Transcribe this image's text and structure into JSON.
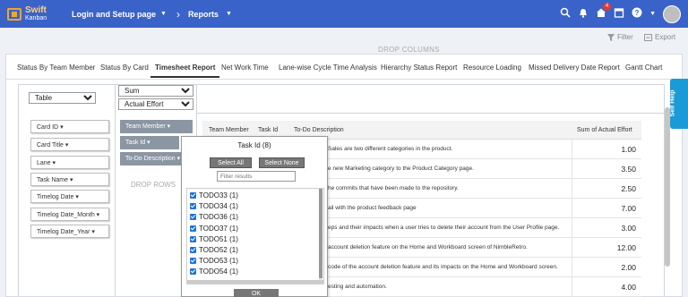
{
  "app": {
    "logo_line1": "Swift",
    "logo_line2": "Kanban",
    "breadcrumb_board": "Login and Setup page",
    "breadcrumb_section": "Reports",
    "notification_count": "4"
  },
  "toolbar": {
    "filter_label": "Filter",
    "export_label": "Export"
  },
  "tabs": [
    "Status By Team Member",
    "Status By Card",
    "Timesheet Report",
    "Net Work Time",
    "Lane-wise Cycle Time Analysis",
    "Hierarchy Status Report",
    "Resource Loading",
    "Missed Delivery Date Report",
    "Gantt Chart"
  ],
  "active_tab": "Timesheet Report",
  "pivot": {
    "renderer": "Table",
    "aggregator": "Sum",
    "aggregator_field": "Actual Effort",
    "drop_columns": "DROP COLUMNS",
    "drop_rows": "DROP ROWS",
    "available_fields": [
      "Card ID",
      "Card Title",
      "Lane",
      "Task Name",
      "Timelog Date",
      "Timelog Date_Month",
      "Timelog Date_Year"
    ],
    "row_fields": [
      "Team Member",
      "Task Id",
      "To-Do Description"
    ]
  },
  "table": {
    "headers": {
      "team_member": "Team Member",
      "task_id": "Task Id",
      "todo": "To-Do Description",
      "sum": "Sum of Actual Effort"
    },
    "rows": [
      {
        "desc": "Sales are two different categories in the product.",
        "value": "1.00"
      },
      {
        "desc": "e new Marketing category to the Product Category page.",
        "value": "3.50"
      },
      {
        "desc": "he commits that have been made to the repository.",
        "value": "2.50"
      },
      {
        "desc": "ail with the product feedback page",
        "value": "7.00"
      },
      {
        "desc": "eps and their impacts when a user tries to delete their account from the User Profile page.",
        "value": "3.00"
      },
      {
        "desc": "account deletion feature on the Home and Workboard screen of NimbleRetro.",
        "value": "12.00"
      },
      {
        "desc": "code of the account deletion feature and its impacts on the Home and Workboard screen.",
        "value": "2.00"
      },
      {
        "desc": "esting and automation.",
        "value": "4.00"
      }
    ]
  },
  "popup": {
    "title": "Task Id (8)",
    "select_all": "Select All",
    "select_none": "Select None",
    "filter_placeholder": "Filter results",
    "ok": "OK",
    "items": [
      "TODO33 (1)",
      "TODO34 (1)",
      "TODO36 (1)",
      "TODO37 (1)",
      "TODO51 (1)",
      "TODO52 (1)",
      "TODO53 (1)",
      "TODO54 (1)"
    ]
  },
  "self_help": "Self Help",
  "colors": {
    "topbar": "#3a63c9",
    "accent": "#1a9bd7",
    "pill": "#8b96a3"
  }
}
